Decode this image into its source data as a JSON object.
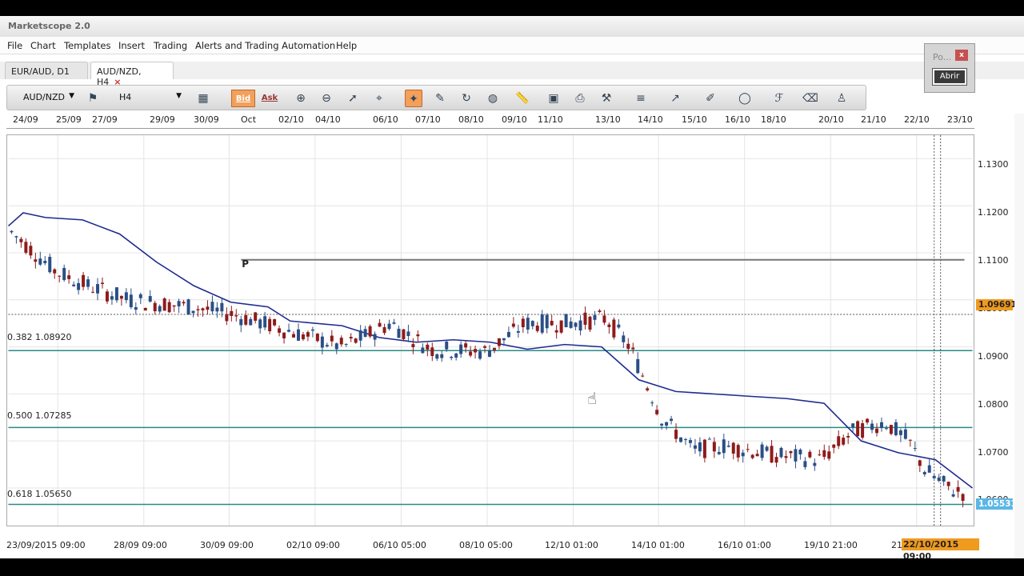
{
  "app": {
    "title": "Marketscope 2.0"
  },
  "menu": [
    "File",
    "Chart",
    "Templates",
    "Insert",
    "Trading",
    "Alerts and Trading Automation",
    "Help"
  ],
  "tabs": [
    {
      "label": "EUR/AUD, D1"
    },
    {
      "label": "AUD/NZD, H4",
      "close": "×"
    }
  ],
  "toolbar": {
    "symbol": "AUD/NZD",
    "timeframe": "H4",
    "bid_label": "Bid",
    "ask_label": "Ask"
  },
  "popup": {
    "title": "Po...",
    "close": "x",
    "button": "Abrir"
  },
  "top_dates": [
    "24/09",
    "25/09",
    "27/09",
    "29/09",
    "30/09",
    "Oct",
    "02/10",
    "04/10",
    "06/10",
    "07/10",
    "08/10",
    "09/10",
    "11/10",
    "13/10",
    "14/10",
    "15/10",
    "16/10",
    "18/10",
    "20/10",
    "21/10",
    "22/10",
    "23/10"
  ],
  "bottom_dates": [
    "23/09/2015 09:00",
    "28/09 09:00",
    "30/09 09:00",
    "02/10 09:00",
    "06/10 05:00",
    "08/10 05:00",
    "12/10 01:00",
    "14/10 01:00",
    "16/10 01:00",
    "19/10 21:00",
    "21"
  ],
  "bottom_highlight": "22/10/2015 09:00",
  "price_ticks": [
    "1.1300",
    "1.1200",
    "1.1100",
    "1.1000",
    "1.0900",
    "1.0800",
    "1.0700",
    "1.0600"
  ],
  "price_tags": {
    "current": "1.09691",
    "low": "1.05531"
  },
  "fib_labels": [
    {
      "label": "0.382 1.08920"
    },
    {
      "label": "0.500 1.07285"
    },
    {
      "label": "0.618 1.05650"
    }
  ],
  "pivot_label": "P",
  "colors": {
    "bull": "#2a4f86",
    "bear": "#8e1b1b",
    "ma": "#1d2a8f",
    "fib": "#2a8a86",
    "bid_tag": "#f09a1e",
    "low_tag": "#5ab7e6"
  },
  "chart_data": {
    "type": "candlestick",
    "symbol": "AUD/NZD",
    "timeframe": "H4",
    "ylim": [
      1.052,
      1.135
    ],
    "fib_levels": [
      1.0892,
      1.07285,
      1.0565
    ],
    "pivot": 1.1085,
    "current_bid": 1.09691,
    "low_marker": 1.05531,
    "ma_path": [
      [
        0,
        1.1157
      ],
      [
        0.02,
        1.1185
      ],
      [
        0.05,
        1.1175
      ],
      [
        0.1,
        1.117
      ],
      [
        0.15,
        1.114
      ],
      [
        0.2,
        1.108
      ],
      [
        0.25,
        1.103
      ],
      [
        0.3,
        1.0995
      ],
      [
        0.35,
        1.0985
      ],
      [
        0.38,
        1.0955
      ],
      [
        0.45,
        1.0945
      ],
      [
        0.5,
        1.092
      ],
      [
        0.55,
        1.091
      ],
      [
        0.6,
        1.0915
      ],
      [
        0.65,
        1.091
      ],
      [
        0.7,
        1.0895
      ],
      [
        0.75,
        1.0905
      ],
      [
        0.8,
        1.09
      ],
      [
        0.85,
        1.083
      ],
      [
        0.9,
        1.0805
      ],
      [
        0.95,
        1.08
      ],
      [
        1.0,
        1.0795
      ],
      [
        1.05,
        1.079
      ],
      [
        1.1,
        1.078
      ],
      [
        1.15,
        1.07
      ],
      [
        1.2,
        1.0675
      ],
      [
        1.25,
        1.066
      ],
      [
        1.3,
        1.06
      ]
    ]
  }
}
